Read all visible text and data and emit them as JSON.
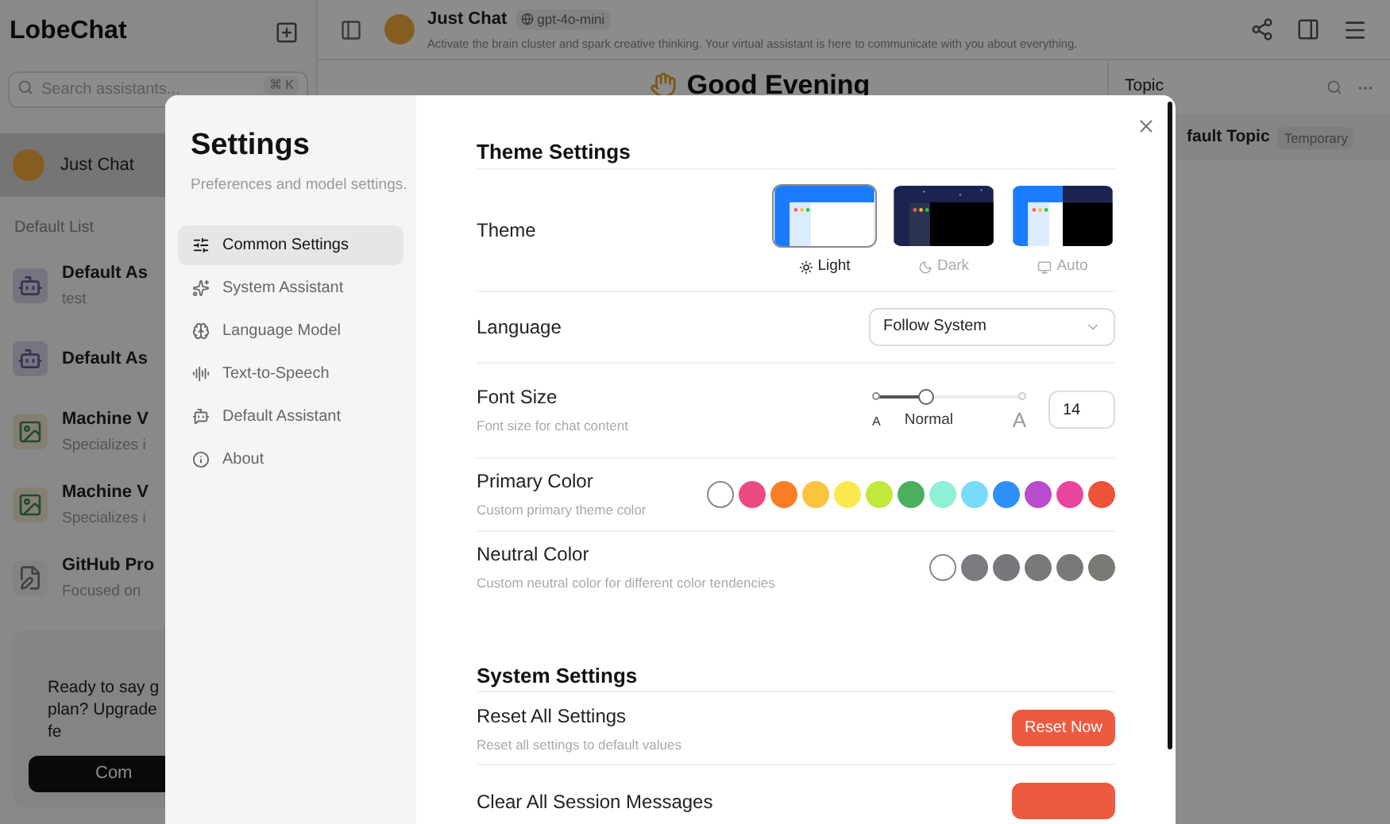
{
  "sidebar": {
    "title": "LobeChat",
    "search": {
      "placeholder": "Search assistants...",
      "shortcut": "⌘ K"
    },
    "sessions": [
      {
        "name": "Just Chat",
        "selected": true
      }
    ],
    "list_title": "Default List",
    "items": [
      {
        "name": "Default As",
        "description": "test",
        "kind": "robot"
      },
      {
        "name": "Default As",
        "kind": "robot"
      },
      {
        "name": "Machine V",
        "description": "Specializes i",
        "kind": "picture"
      },
      {
        "name": "Machine V",
        "description": "Specializes i",
        "kind": "picture"
      },
      {
        "name": "GitHub Pro",
        "description": "Focused on",
        "kind": "document"
      }
    ],
    "upgrade_card": {
      "text": "Ready to say g\nplan? Upgrade\nfe",
      "button": "Com"
    }
  },
  "header": {
    "title": "Just Chat",
    "model": "gpt-4o-mini",
    "description": "Activate the brain cluster and spark creative thinking. Your virtual assistant is here to communicate with you about everything."
  },
  "greeting": "Good Evening",
  "topic_panel": {
    "title": "Topic",
    "topics": [
      {
        "name": "fault Topic",
        "tag": "Temporary"
      }
    ]
  },
  "settings": {
    "title": "Settings",
    "subtitle": "Preferences and model settings.",
    "nav": [
      {
        "label": "Common Settings",
        "selected": true
      },
      {
        "label": "System Assistant",
        "selected": false
      },
      {
        "label": "Language Model",
        "selected": false
      },
      {
        "label": "Text-to-Speech",
        "selected": false
      },
      {
        "label": "Default Assistant",
        "selected": false
      },
      {
        "label": "About",
        "selected": false
      }
    ],
    "theme_section": {
      "title": "Theme Settings",
      "theme": {
        "label": "Theme",
        "options": [
          {
            "label": "Light",
            "kind": "light",
            "selected": true
          },
          {
            "label": "Dark",
            "kind": "dark",
            "selected": false
          },
          {
            "label": "Auto",
            "kind": "auto",
            "selected": false
          }
        ]
      },
      "language": {
        "label": "Language",
        "value": "Follow System"
      },
      "font_size": {
        "label": "Font Size",
        "description": "Font size for chat content",
        "level": 0.34,
        "marks": [
          "A",
          "Normal",
          "A"
        ],
        "value": "14"
      },
      "primary_color": {
        "label": "Primary Color",
        "description": "Custom primary theme color",
        "swatches": [
          {
            "color": "#ffffff"
          },
          {
            "color": "#eb4a7f"
          },
          {
            "color": "#fa7d25"
          },
          {
            "color": "#fcc33f"
          },
          {
            "color": "#fbe84e"
          },
          {
            "color": "#c0e93c"
          },
          {
            "color": "#4caf5f"
          },
          {
            "color": "#8ff0d8"
          },
          {
            "color": "#78dcf9"
          },
          {
            "color": "#2f8ffa"
          },
          {
            "color": "#b84ccc"
          },
          {
            "color": "#e8459f"
          },
          {
            "color": "#ec5339"
          }
        ]
      },
      "neutral_color": {
        "label": "Neutral Color",
        "description": "Custom neutral color for different color tendencies",
        "swatches": [
          {
            "color": "#ffffff"
          },
          {
            "color": "#7b7a80"
          },
          {
            "color": "#77787c"
          },
          {
            "color": "#787a78"
          },
          {
            "color": "#79797a"
          },
          {
            "color": "#7a7a74"
          }
        ]
      }
    },
    "system_section": {
      "title": "System Settings",
      "rows": [
        {
          "label": "Reset All Settings",
          "description": "Reset all settings to default values",
          "button": "Reset Now"
        },
        {
          "label": "Clear All Session Messages"
        }
      ]
    }
  }
}
